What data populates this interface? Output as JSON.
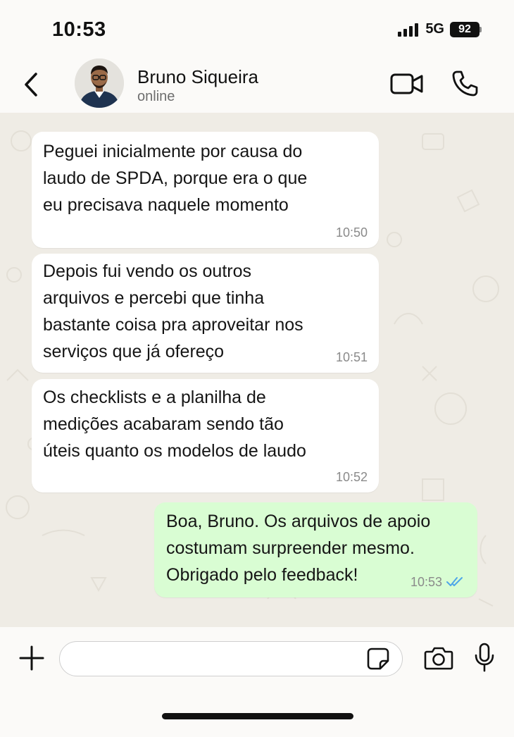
{
  "status_bar": {
    "time": "10:53",
    "network": "5G",
    "battery": "92"
  },
  "header": {
    "contact_name": "Bruno Siqueira",
    "contact_status": "online"
  },
  "messages": [
    {
      "direction": "in",
      "text": "Peguei inicialmente por causa do\nlaudo de SPDA, porque era o que\neu precisava naquele momento",
      "time": "10:50"
    },
    {
      "direction": "in",
      "text": "Depois fui vendo os outros\narquivos e percebi que tinha\nbastante coisa pra aproveitar nos\nserviços que já ofereço",
      "time": "10:51"
    },
    {
      "direction": "in",
      "text": "Os checklists e a planilha de\nmedições acabaram sendo tão\núteis quanto os modelos de laudo",
      "time": "10:52"
    },
    {
      "direction": "out",
      "text": "Boa, Bruno. Os arquivos de apoio\ncostumam surpreender mesmo.\nObrigado pelo feedback!",
      "time": "10:53",
      "status": "read"
    }
  ],
  "input": {
    "value": "",
    "placeholder": ""
  },
  "icons": {
    "back": "chevron-left-icon",
    "video": "video-camera-icon",
    "call": "phone-icon",
    "plus": "plus-icon",
    "sticker": "sticker-icon",
    "camera": "camera-icon",
    "mic": "microphone-icon",
    "read_ticks": "double-check-icon"
  },
  "colors": {
    "incoming_bubble": "#ffffff",
    "outgoing_bubble": "#d9fdd3",
    "read_ticks": "#4fa6e8",
    "chat_background": "#efece5"
  }
}
